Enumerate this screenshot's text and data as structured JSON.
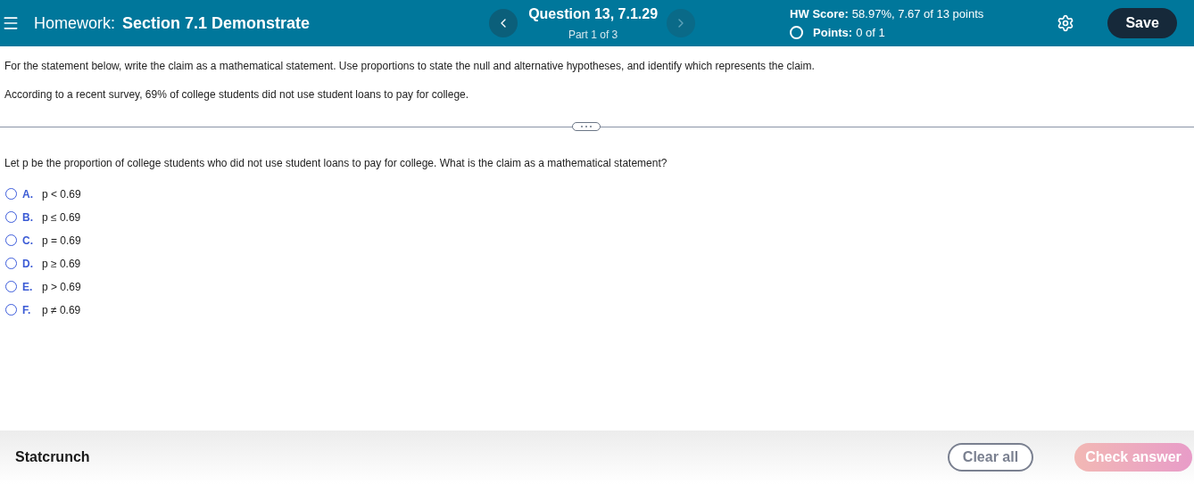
{
  "header": {
    "homework_label": "Homework:",
    "homework_title": "Section 7.1 Demonstrate",
    "question_title": "Question 13, 7.1.29",
    "question_part": "Part 1 of 3",
    "prev_disabled": false,
    "next_disabled": true,
    "score_label": "HW Score:",
    "score_value": "58.97%, 7.67 of 13 points",
    "points_label": "Points:",
    "points_value": "0 of 1",
    "save": "Save"
  },
  "instructions": "For the statement below, write the claim as a mathematical statement. Use proportions to state the null and alternative hypotheses, and identify which represents the claim.",
  "statement": "According to a recent survey, 69% of college students did not use student loans to pay for college.",
  "question": "Let p be the proportion of college students who did not use student loans to pay for college. What is the claim as a mathematical statement?",
  "options": [
    {
      "letter": "A.",
      "text": "p < 0.69",
      "selected": false
    },
    {
      "letter": "B.",
      "text": "p ≤ 0.69",
      "selected": false
    },
    {
      "letter": "C.",
      "text": "p = 0.69",
      "selected": false
    },
    {
      "letter": "D.",
      "text": "p ≥ 0.69",
      "selected": false
    },
    {
      "letter": "E.",
      "text": "p > 0.69",
      "selected": false
    },
    {
      "letter": "F.",
      "text": "p ≠ 0.69",
      "selected": false
    }
  ],
  "footer": {
    "statcrunch": "Statcrunch",
    "clear": "Clear all",
    "check": "Check answer",
    "check_disabled": true
  }
}
